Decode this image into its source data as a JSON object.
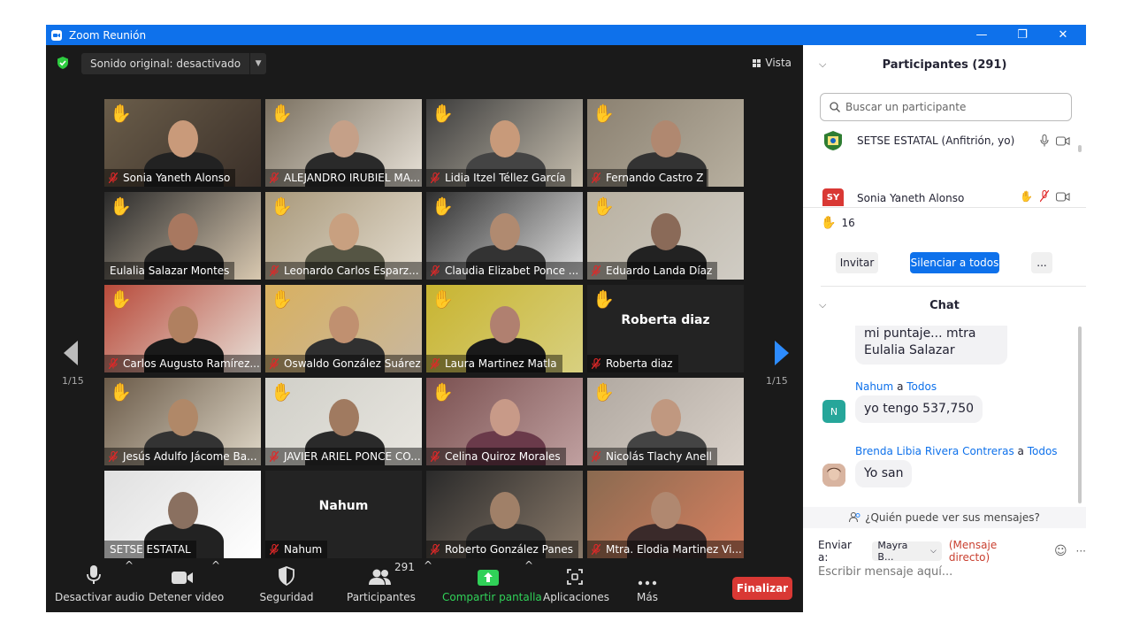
{
  "window": {
    "title": "Zoom Reunión",
    "minimize": "—",
    "restore": "❐",
    "close": "✕"
  },
  "topbar": {
    "sound_label": "Sonido original: desactivado",
    "view_label": "Vista"
  },
  "pager": {
    "left": "1/15",
    "right": "1/15"
  },
  "tiles": [
    {
      "name": "Sonia Yaneth Alonso",
      "hand": true
    },
    {
      "name": "ALEJANDRO IRUBIEL MA...",
      "hand": true
    },
    {
      "name": "Lidia Itzel Téllez García",
      "hand": true
    },
    {
      "name": "Fernando Castro Z",
      "hand": true
    },
    {
      "name": "Eulalia Salazar Montes",
      "hand": true,
      "active": true
    },
    {
      "name": "Leonardo Carlos Esparz...",
      "hand": true
    },
    {
      "name": "Claudia Elizabet Ponce ...",
      "hand": true
    },
    {
      "name": "Eduardo Landa Díaz",
      "hand": true
    },
    {
      "name": "Carlos Augusto Ramírez...",
      "hand": true
    },
    {
      "name": "Oswaldo González Suárez",
      "hand": true
    },
    {
      "name": "Laura Martinez Matla",
      "hand": true
    },
    {
      "name": "Roberta diaz",
      "hand": true,
      "big_name": "Roberta diaz"
    },
    {
      "name": "Jesús Adulfo Jácome Ba...",
      "hand": true
    },
    {
      "name": "JAVIER ARIEL PONCE CO...",
      "hand": true
    },
    {
      "name": "Celina Quiroz Morales",
      "hand": true
    },
    {
      "name": "Nicolás Tlachy Anell",
      "hand": true
    },
    {
      "name": "SETSE ESTATAL",
      "hand": false
    },
    {
      "name": "Nahum",
      "hand": false,
      "big_name": "Nahum"
    },
    {
      "name": "Roberto González Panes",
      "hand": false
    },
    {
      "name": "Mtra. Elodia Martinez Vi...",
      "hand": false
    }
  ],
  "toolbar": {
    "audio": "Desactivar audio",
    "video": "Detener video",
    "security": "Seguridad",
    "participants": "Participantes",
    "participants_count": "291",
    "share": "Compartir pantalla",
    "apps": "Aplicaciones",
    "more": "Más",
    "end": "Finalizar"
  },
  "participants_panel": {
    "title": "Participantes (291)",
    "search_placeholder": "Buscar un participante",
    "rows": [
      {
        "name": "SETSE ESTATAL (Anfitrión, yo)",
        "initials": ""
      },
      {
        "name": "Sonia Yaneth Alonso",
        "initials": "SY"
      }
    ],
    "hands_count": "16",
    "invite": "Invitar",
    "mute_all": "Silenciar a todos",
    "more": "..."
  },
  "chat": {
    "title": "Chat",
    "prev_message": [
      "mi puntaje... mtra",
      "Eulalia Salazar"
    ],
    "messages": [
      {
        "from": "Nahum",
        "to_label": "a",
        "to": "Todos",
        "initial": "N",
        "text": "yo tengo 537,750"
      },
      {
        "from": "Brenda Libia Rivera Contreras",
        "to_label": "a",
        "to": "Todos",
        "initial": "",
        "text": "Yo san"
      }
    ],
    "who_can_see": "¿Quién puede ver sus mensajes?",
    "send_to_label": "Enviar a:",
    "send_to_value": "Mayra B...",
    "direct": "(Mensaje directo)",
    "input_placeholder": "Escribir mensaje aquí..."
  },
  "colors": {
    "zoom_blue": "#0e71eb",
    "end_red": "#d93834",
    "share_green": "#30d158",
    "mic_red": "#e02828"
  }
}
